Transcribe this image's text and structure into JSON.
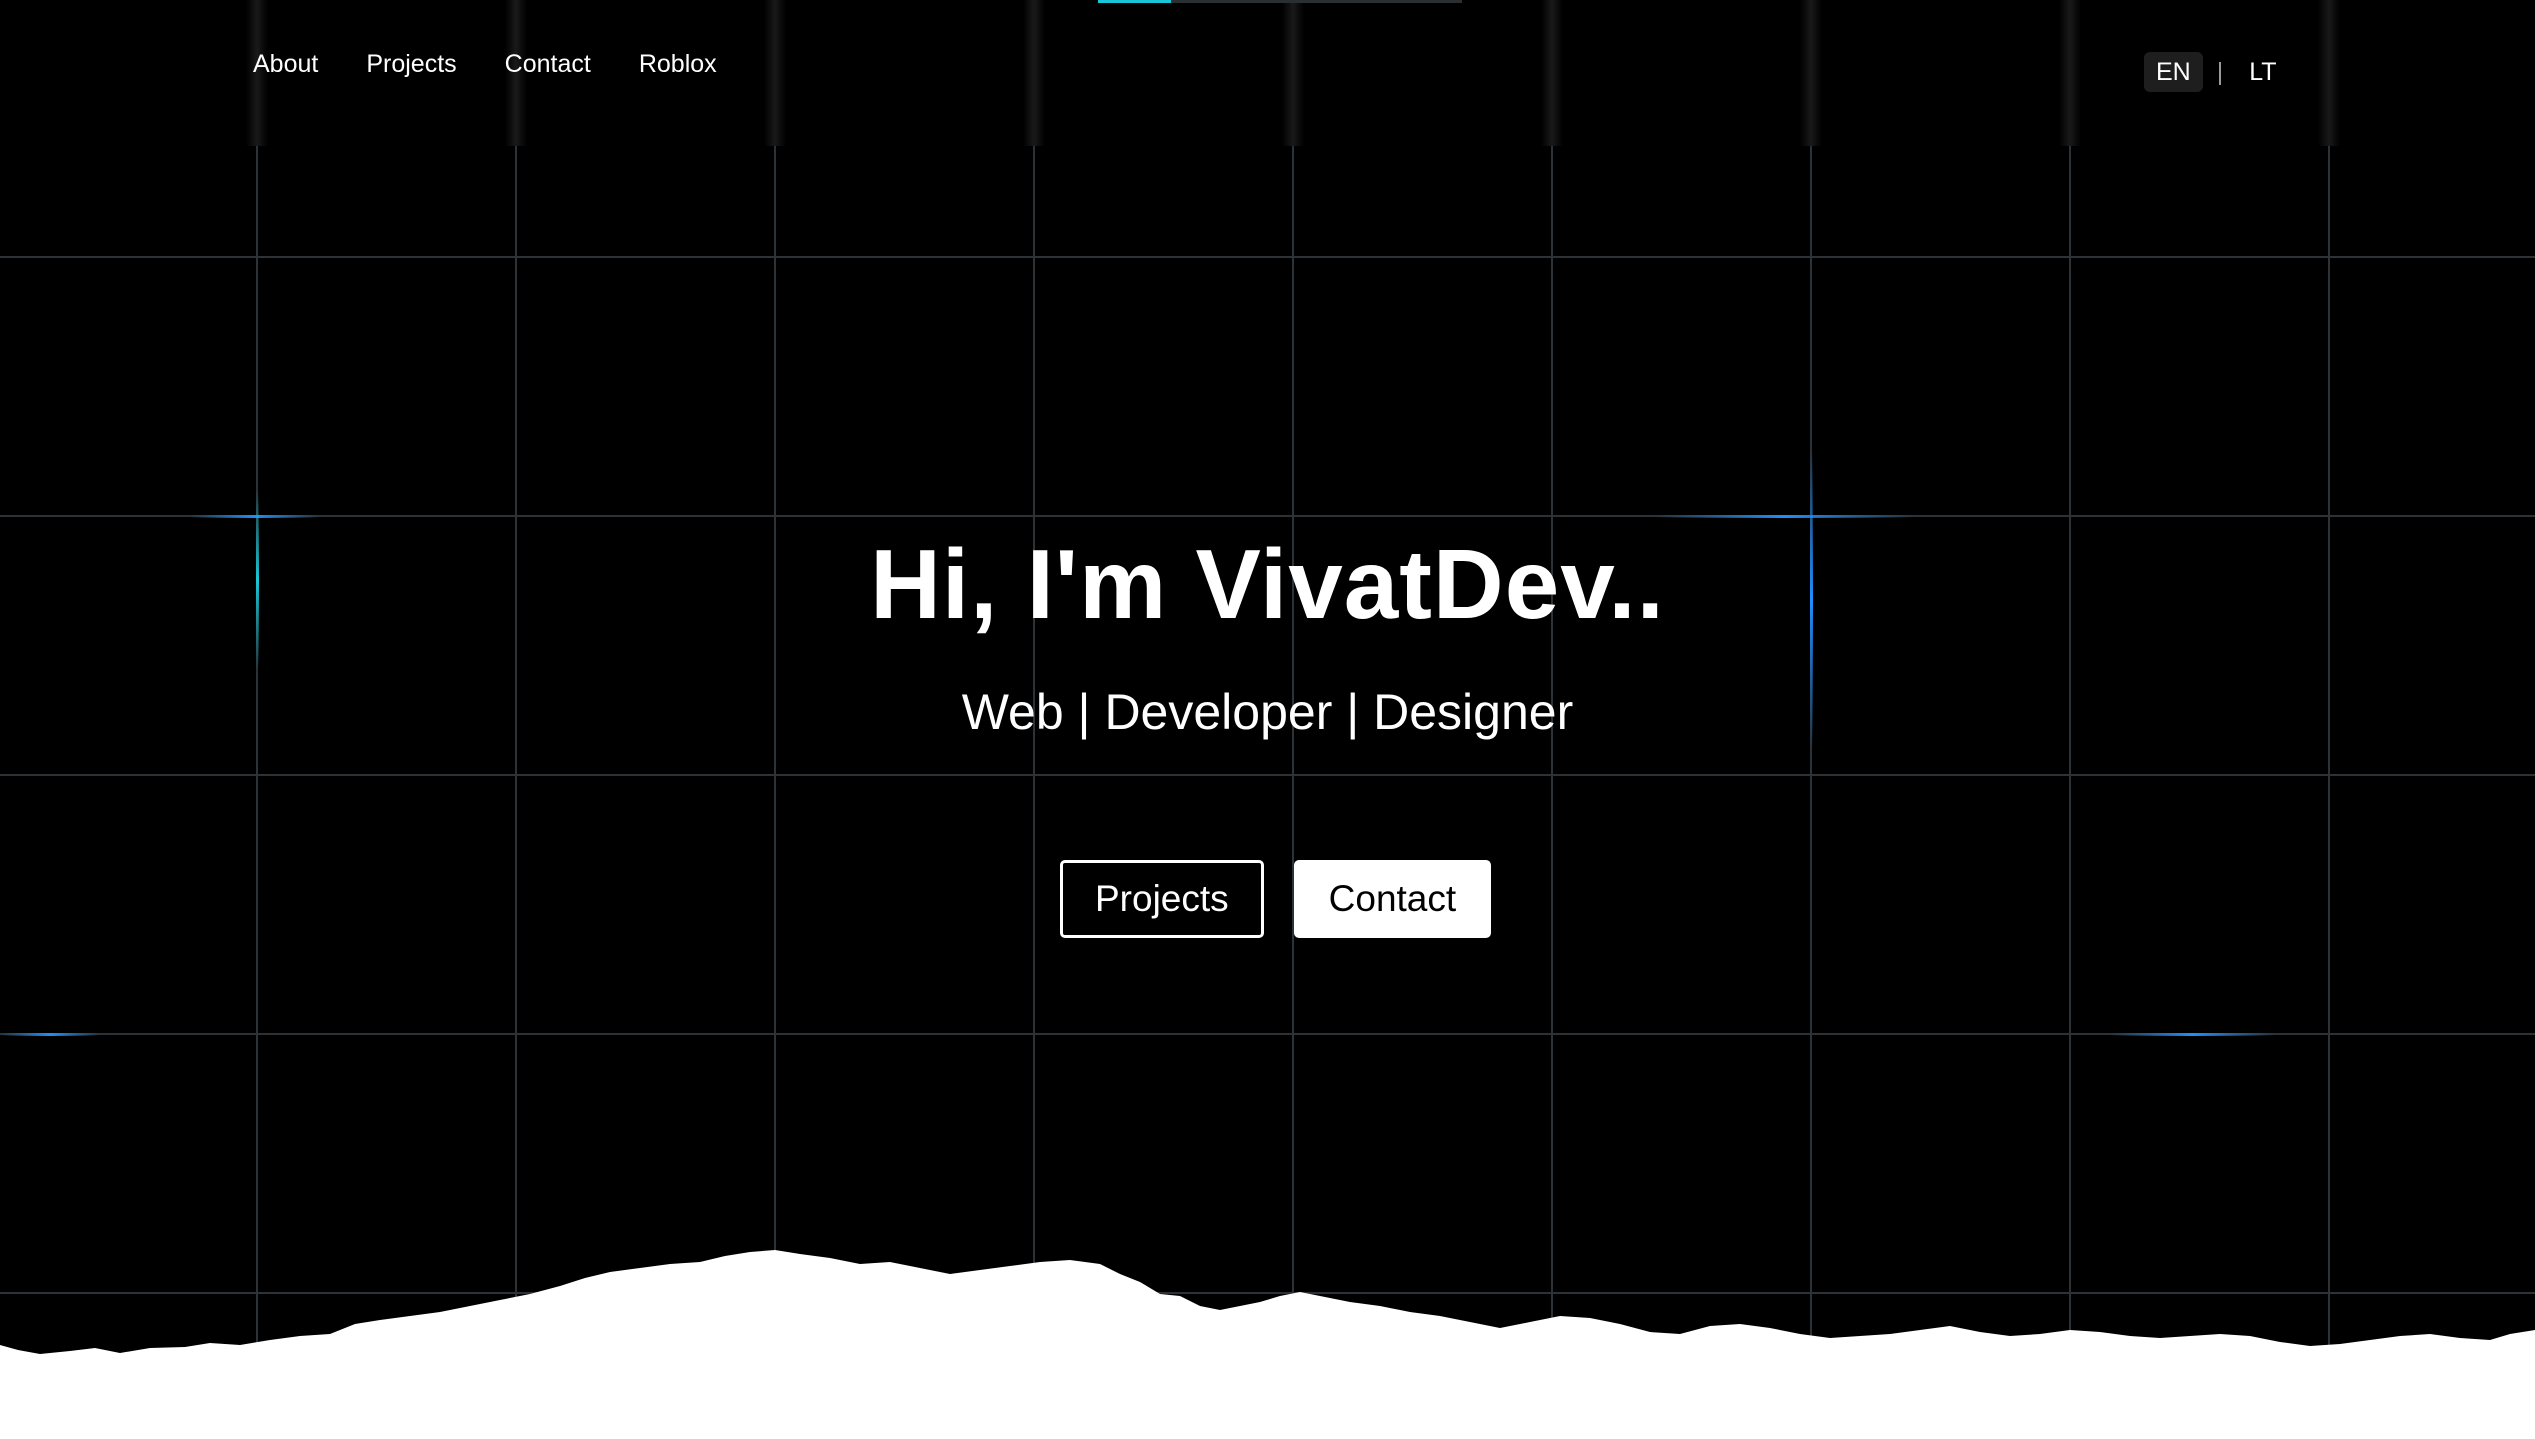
{
  "nav": {
    "items": [
      {
        "label": "About"
      },
      {
        "label": "Projects"
      },
      {
        "label": "Contact"
      },
      {
        "label": "Roblox"
      }
    ]
  },
  "language": {
    "options": [
      "EN",
      "LT"
    ],
    "active": "EN",
    "separator": "|"
  },
  "hero": {
    "title": "Hi, I'm VivatDev..",
    "subtitle": "Web | Developer | Designer",
    "buttons": {
      "projects_label": "Projects",
      "contact_label": "Contact"
    }
  },
  "scroll_progress": 0.2,
  "colors": {
    "background": "#000000",
    "grid": "#2c3236",
    "accent_blue": "#1f8fff",
    "accent_cyan": "#19c6d6",
    "text": "#ffffff"
  }
}
